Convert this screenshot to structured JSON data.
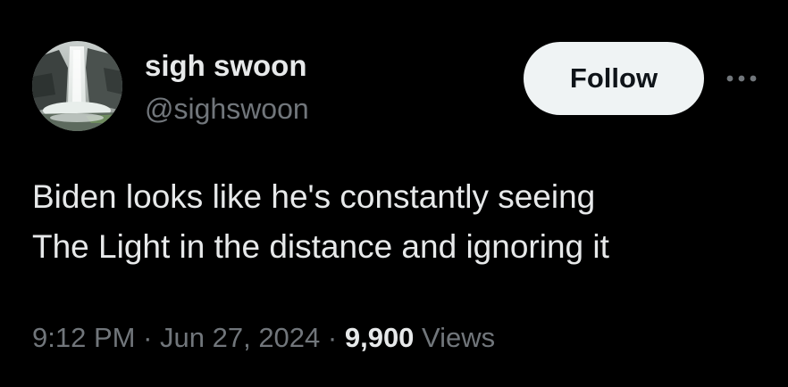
{
  "author": {
    "display_name": "sigh swoon",
    "handle": "@sighswoon",
    "avatar_icon": "waterfall-photo"
  },
  "actions": {
    "follow_label": "Follow",
    "more_icon": "ellipsis-icon"
  },
  "tweet": {
    "lines": [
      "Biden looks like he's constantly seeing",
      "The Light in the distance and ignoring it"
    ]
  },
  "meta": {
    "time": "9:12 PM",
    "separator": " · ",
    "date": "Jun 27, 2024",
    "views_count": "9,900",
    "views_label": "Views"
  },
  "colors": {
    "background": "#000000",
    "primary_text": "#e7e9ea",
    "secondary_text": "#71767b",
    "follow_bg": "#eff3f4",
    "follow_text": "#0f1419"
  }
}
